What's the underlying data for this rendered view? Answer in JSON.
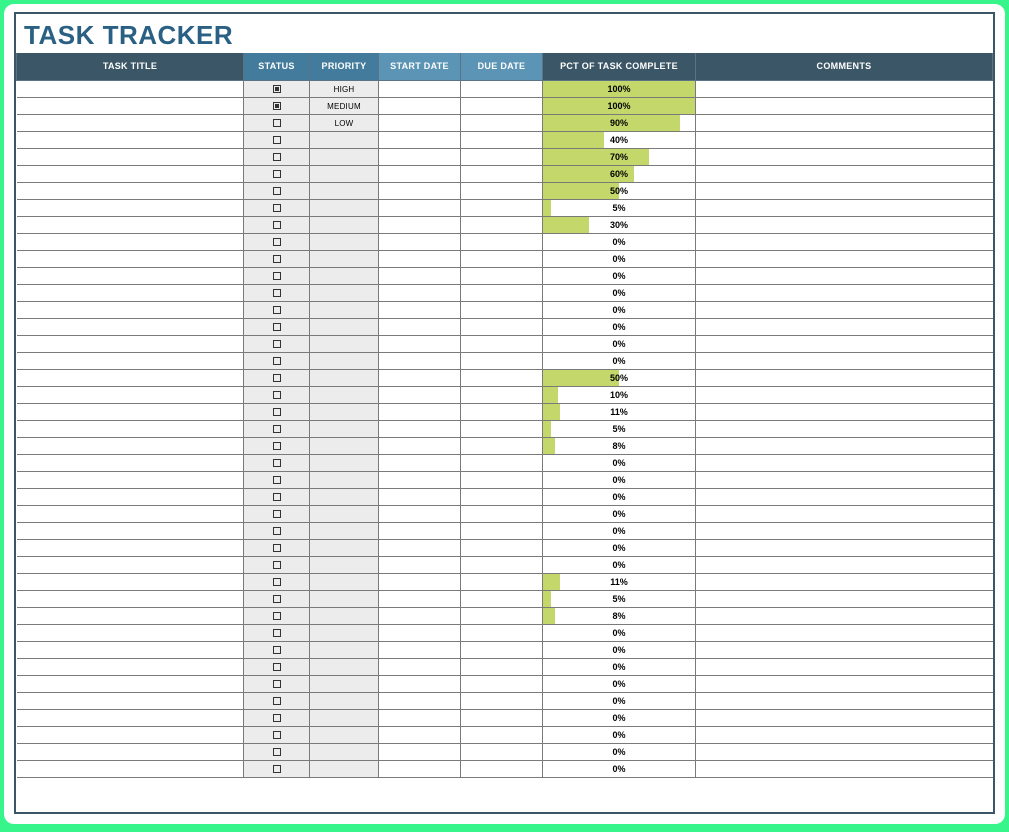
{
  "title": "TASK TRACKER",
  "columns": {
    "task_title": "TASK TITLE",
    "status": "STATUS",
    "priority": "PRIORITY",
    "start_date": "START DATE",
    "due_date": "DUE DATE",
    "pct": "PCT OF TASK COMPLETE",
    "comments": "COMMENTS"
  },
  "chart_data": {
    "type": "table",
    "columns": [
      "task_title",
      "status_checked",
      "priority",
      "start_date",
      "due_date",
      "pct_complete",
      "comments"
    ],
    "rows": [
      {
        "status_checked": true,
        "priority": "HIGH",
        "pct_complete": 100
      },
      {
        "status_checked": true,
        "priority": "MEDIUM",
        "pct_complete": 100
      },
      {
        "status_checked": false,
        "priority": "LOW",
        "pct_complete": 90
      },
      {
        "status_checked": false,
        "priority": "",
        "pct_complete": 40
      },
      {
        "status_checked": false,
        "priority": "",
        "pct_complete": 70
      },
      {
        "status_checked": false,
        "priority": "",
        "pct_complete": 60
      },
      {
        "status_checked": false,
        "priority": "",
        "pct_complete": 50
      },
      {
        "status_checked": false,
        "priority": "",
        "pct_complete": 5
      },
      {
        "status_checked": false,
        "priority": "",
        "pct_complete": 30
      },
      {
        "status_checked": false,
        "priority": "",
        "pct_complete": 0
      },
      {
        "status_checked": false,
        "priority": "",
        "pct_complete": 0
      },
      {
        "status_checked": false,
        "priority": "",
        "pct_complete": 0
      },
      {
        "status_checked": false,
        "priority": "",
        "pct_complete": 0
      },
      {
        "status_checked": false,
        "priority": "",
        "pct_complete": 0
      },
      {
        "status_checked": false,
        "priority": "",
        "pct_complete": 0
      },
      {
        "status_checked": false,
        "priority": "",
        "pct_complete": 0
      },
      {
        "status_checked": false,
        "priority": "",
        "pct_complete": 0
      },
      {
        "status_checked": false,
        "priority": "",
        "pct_complete": 50
      },
      {
        "status_checked": false,
        "priority": "",
        "pct_complete": 10
      },
      {
        "status_checked": false,
        "priority": "",
        "pct_complete": 11
      },
      {
        "status_checked": false,
        "priority": "",
        "pct_complete": 5
      },
      {
        "status_checked": false,
        "priority": "",
        "pct_complete": 8
      },
      {
        "status_checked": false,
        "priority": "",
        "pct_complete": 0
      },
      {
        "status_checked": false,
        "priority": "",
        "pct_complete": 0
      },
      {
        "status_checked": false,
        "priority": "",
        "pct_complete": 0
      },
      {
        "status_checked": false,
        "priority": "",
        "pct_complete": 0
      },
      {
        "status_checked": false,
        "priority": "",
        "pct_complete": 0
      },
      {
        "status_checked": false,
        "priority": "",
        "pct_complete": 0
      },
      {
        "status_checked": false,
        "priority": "",
        "pct_complete": 0
      },
      {
        "status_checked": false,
        "priority": "",
        "pct_complete": 11
      },
      {
        "status_checked": false,
        "priority": "",
        "pct_complete": 5
      },
      {
        "status_checked": false,
        "priority": "",
        "pct_complete": 8
      },
      {
        "status_checked": false,
        "priority": "",
        "pct_complete": 0
      },
      {
        "status_checked": false,
        "priority": "",
        "pct_complete": 0
      },
      {
        "status_checked": false,
        "priority": "",
        "pct_complete": 0
      },
      {
        "status_checked": false,
        "priority": "",
        "pct_complete": 0
      },
      {
        "status_checked": false,
        "priority": "",
        "pct_complete": 0
      },
      {
        "status_checked": false,
        "priority": "",
        "pct_complete": 0
      },
      {
        "status_checked": false,
        "priority": "",
        "pct_complete": 0
      },
      {
        "status_checked": false,
        "priority": "",
        "pct_complete": 0
      },
      {
        "status_checked": false,
        "priority": "",
        "pct_complete": 0
      }
    ]
  }
}
